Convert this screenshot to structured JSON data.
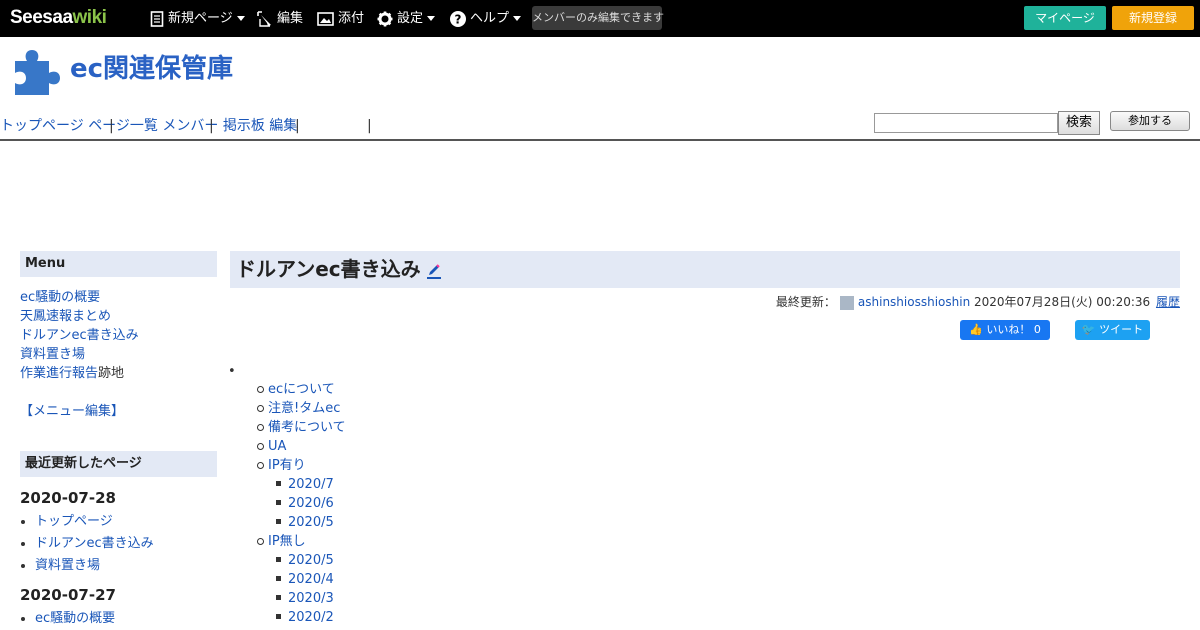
{
  "topbar": {
    "logo_part1": "Seesaa",
    "logo_part2": "wiki",
    "new_page": "新規ページ",
    "edit": "編集",
    "attach": "添付",
    "settings": "設定",
    "help": "ヘルプ",
    "members_only": "メンバーのみ編集できます",
    "mypage": "マイページ",
    "register": "新規登録"
  },
  "header": {
    "site_title": "ec関連保管庫",
    "nav": [
      "トップページ",
      "ページ一覧",
      "メンバー",
      "掲示板",
      "編集"
    ],
    "search_value": "",
    "search_button": "検索",
    "join_button": "参加する"
  },
  "sidebar": {
    "menu_title": "Menu",
    "menu_links": [
      {
        "link": "ec騒動の概要"
      },
      {
        "link": "天鳳速報まとめ"
      },
      {
        "link": "ドルアンec書き込み"
      },
      {
        "link": "資料置き場"
      },
      {
        "link": "作業進行報告",
        "suffix": "跡地"
      }
    ],
    "menu_edit": "【メニュー編集】",
    "recent_title": "最近更新したページ",
    "recent_groups": [
      {
        "date": "2020-07-28",
        "items": [
          "トップページ",
          "ドルアンec書き込み",
          "資料置き場"
        ]
      },
      {
        "date": "2020-07-27",
        "items": [
          "ec騒動の概要"
        ]
      }
    ]
  },
  "main": {
    "page_title": "ドルアンec書き込み",
    "last_updated_label": "最終更新：",
    "author": "ashinshiosshioshin",
    "updated_at": "2020年07月28日(火) 00:20:36",
    "history": "履歴",
    "like_button": "いいね！ 0",
    "tweet_button": "ツイート",
    "toc": [
      {
        "label": "ecについて",
        "level": 1
      },
      {
        "label": "注意!タムec",
        "level": 1
      },
      {
        "label": "備考について",
        "level": 1
      },
      {
        "label": "UA",
        "level": 1
      },
      {
        "label": "IP有り",
        "level": 1
      },
      {
        "label": "2020/7",
        "level": 2
      },
      {
        "label": "2020/6",
        "level": 2
      },
      {
        "label": "2020/5",
        "level": 2
      },
      {
        "label": "IP無し",
        "level": 1
      },
      {
        "label": "2020/5",
        "level": 2
      },
      {
        "label": "2020/4",
        "level": 2
      },
      {
        "label": "2020/3",
        "level": 2
      },
      {
        "label": "2020/2",
        "level": 2
      }
    ]
  },
  "colors": {
    "accent": "#2a62c4",
    "link": "#1a56b8",
    "mypage": "#1fb29a",
    "register": "#f0a30a",
    "section_bg": "#e3e9f5"
  }
}
